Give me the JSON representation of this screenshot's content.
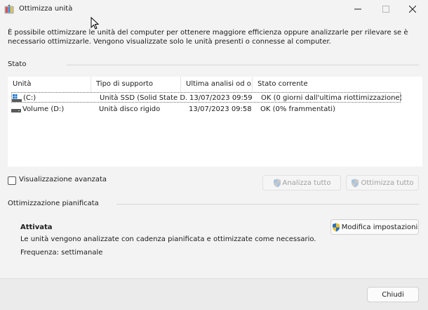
{
  "window": {
    "title": "Ottimizza unità"
  },
  "intro_text": "È possibile ottimizzare le unità del computer per ottenere maggiore efficienza oppure analizzarle per rilevare se è necessario ottimizzarle. Vengono visualizzate solo le unità presenti o connesse al computer.",
  "status_section": {
    "label": "Stato"
  },
  "drives_table": {
    "columns": [
      "Unità",
      "Tipo di supporto",
      "Ultima analisi od o...",
      "Stato corrente"
    ],
    "rows": [
      {
        "name": "(C:)",
        "type": "Unità SSD (Solid State D...",
        "last_run": "13/07/2023 09:59",
        "status": "OK (0 giorni dall'ultima riottimizzazione)",
        "icon": "windows-drive-icon",
        "selected": true
      },
      {
        "name": "Volume (D:)",
        "type": "Unità disco rigido",
        "last_run": "13/07/2023 09:58",
        "status": "OK (0% frammentati)",
        "icon": "hard-drive-icon",
        "selected": false
      }
    ]
  },
  "advanced_view": {
    "label": "Visualizzazione avanzata",
    "checked": false
  },
  "buttons": {
    "analyze_all": "Analizza tutto",
    "optimize_all": "Ottimizza tutto",
    "change_settings": "Modifica impostazioni",
    "close": "Chiudi"
  },
  "scheduled": {
    "label": "Ottimizzazione pianificata",
    "state": "Attivata",
    "description": "Le unità vengono analizzate con cadenza pianificata e ottimizzate come necessario.",
    "frequency": "Frequenza: settimanale"
  },
  "colors": {
    "accent": "#0067c0",
    "window_bg": "#f3f3f3",
    "disabled_text": "#a0a0a0"
  }
}
